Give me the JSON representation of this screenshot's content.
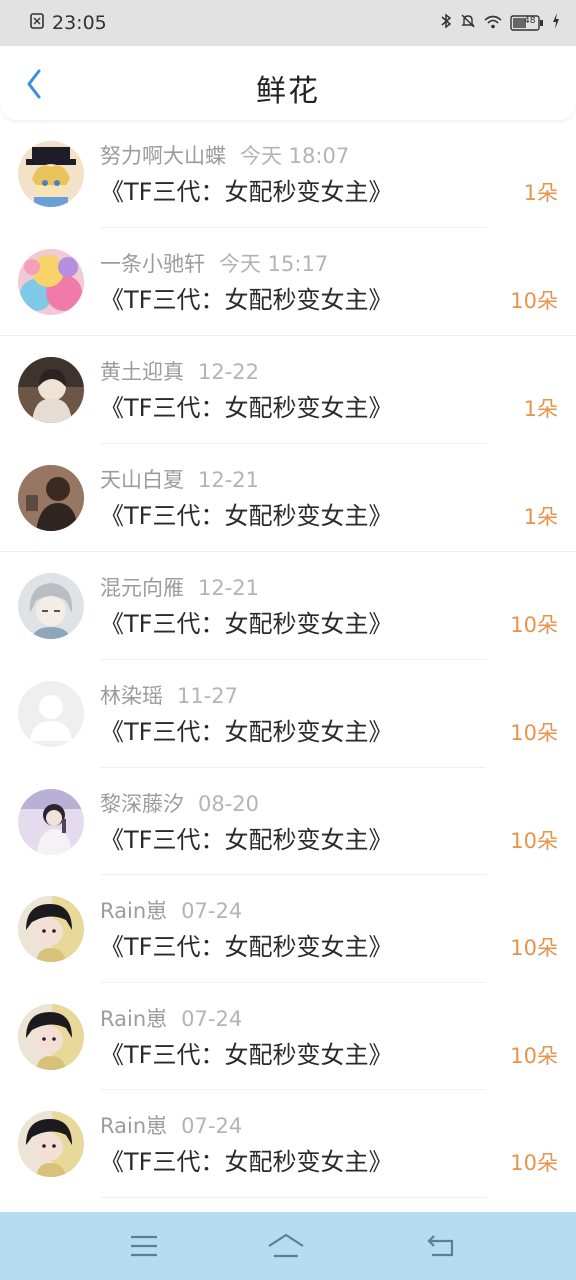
{
  "status_bar": {
    "time": "23:05",
    "battery": "48"
  },
  "header": {
    "title": "鲜花"
  },
  "colors": {
    "accent": "#3a8fe0",
    "count": "#e8924a",
    "nav_bg": "#b7dcef"
  },
  "rows": [
    {
      "user": "努力啊大山蝶",
      "time": "今天 18:07",
      "book": "《TF三代：女配秒变女主》",
      "count": "1朵"
    },
    {
      "user": "一条小驰轩",
      "time": "今天 15:17",
      "book": "《TF三代：女配秒变女主》",
      "count": "10朵"
    },
    {
      "user": "黄土迎真",
      "time": "12-22",
      "book": "《TF三代：女配秒变女主》",
      "count": "1朵"
    },
    {
      "user": "天山白夏",
      "time": "12-21",
      "book": "《TF三代：女配秒变女主》",
      "count": "1朵"
    },
    {
      "user": "混元向雁",
      "time": "12-21",
      "book": "《TF三代：女配秒变女主》",
      "count": "10朵"
    },
    {
      "user": "林染瑶",
      "time": "11-27",
      "book": "《TF三代：女配秒变女主》",
      "count": "10朵"
    },
    {
      "user": "黎深藤汐",
      "time": "08-20",
      "book": "《TF三代：女配秒变女主》",
      "count": "10朵"
    },
    {
      "user": "Rain崽",
      "time": "07-24",
      "book": "《TF三代：女配秒变女主》",
      "count": "10朵"
    },
    {
      "user": "Rain崽",
      "time": "07-24",
      "book": "《TF三代：女配秒变女主》",
      "count": "10朵"
    },
    {
      "user": "Rain崽",
      "time": "07-24",
      "book": "《TF三代：女配秒变女主》",
      "count": "10朵"
    }
  ],
  "nav": {
    "icons": [
      "menu-icon",
      "home-icon",
      "back-icon"
    ]
  }
}
